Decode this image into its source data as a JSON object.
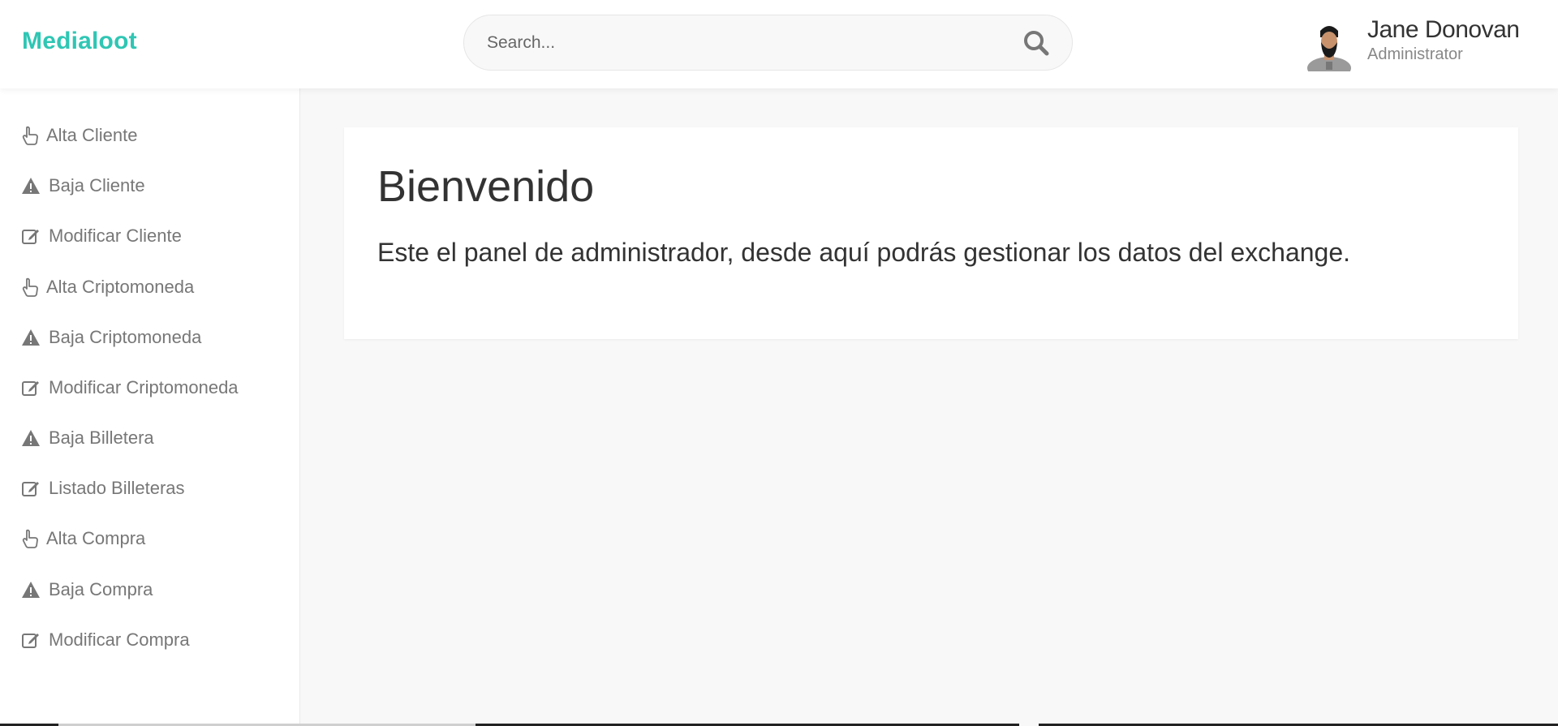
{
  "header": {
    "brand": "Medialoot",
    "search": {
      "placeholder": "Search...",
      "icon": "search-icon"
    },
    "user": {
      "name": "Jane Donovan",
      "role": "Administrator"
    }
  },
  "sidebar": {
    "items": [
      {
        "label": "Alta Cliente",
        "icon": "hand-pointer-icon"
      },
      {
        "label": "Baja Cliente",
        "icon": "warning-icon"
      },
      {
        "label": "Modificar Cliente",
        "icon": "edit-icon"
      },
      {
        "label": "Alta Criptomoneda",
        "icon": "hand-pointer-icon"
      },
      {
        "label": "Baja Criptomoneda",
        "icon": "warning-icon"
      },
      {
        "label": "Modificar Criptomoneda",
        "icon": "edit-icon"
      },
      {
        "label": "Baja Billetera",
        "icon": "warning-icon"
      },
      {
        "label": "Listado Billeteras",
        "icon": "edit-icon"
      },
      {
        "label": "Alta Compra",
        "icon": "hand-pointer-icon"
      },
      {
        "label": "Baja Compra",
        "icon": "warning-icon"
      },
      {
        "label": "Modificar Compra",
        "icon": "edit-icon"
      }
    ]
  },
  "main": {
    "title": "Bienvenido",
    "description": "Este el panel de administrador, desde aquí podrás gestionar los datos del exchange."
  },
  "colors": {
    "brand": "#2fc6b4",
    "text": "#333333",
    "muted": "#777777",
    "background": "#f8f8f8"
  }
}
